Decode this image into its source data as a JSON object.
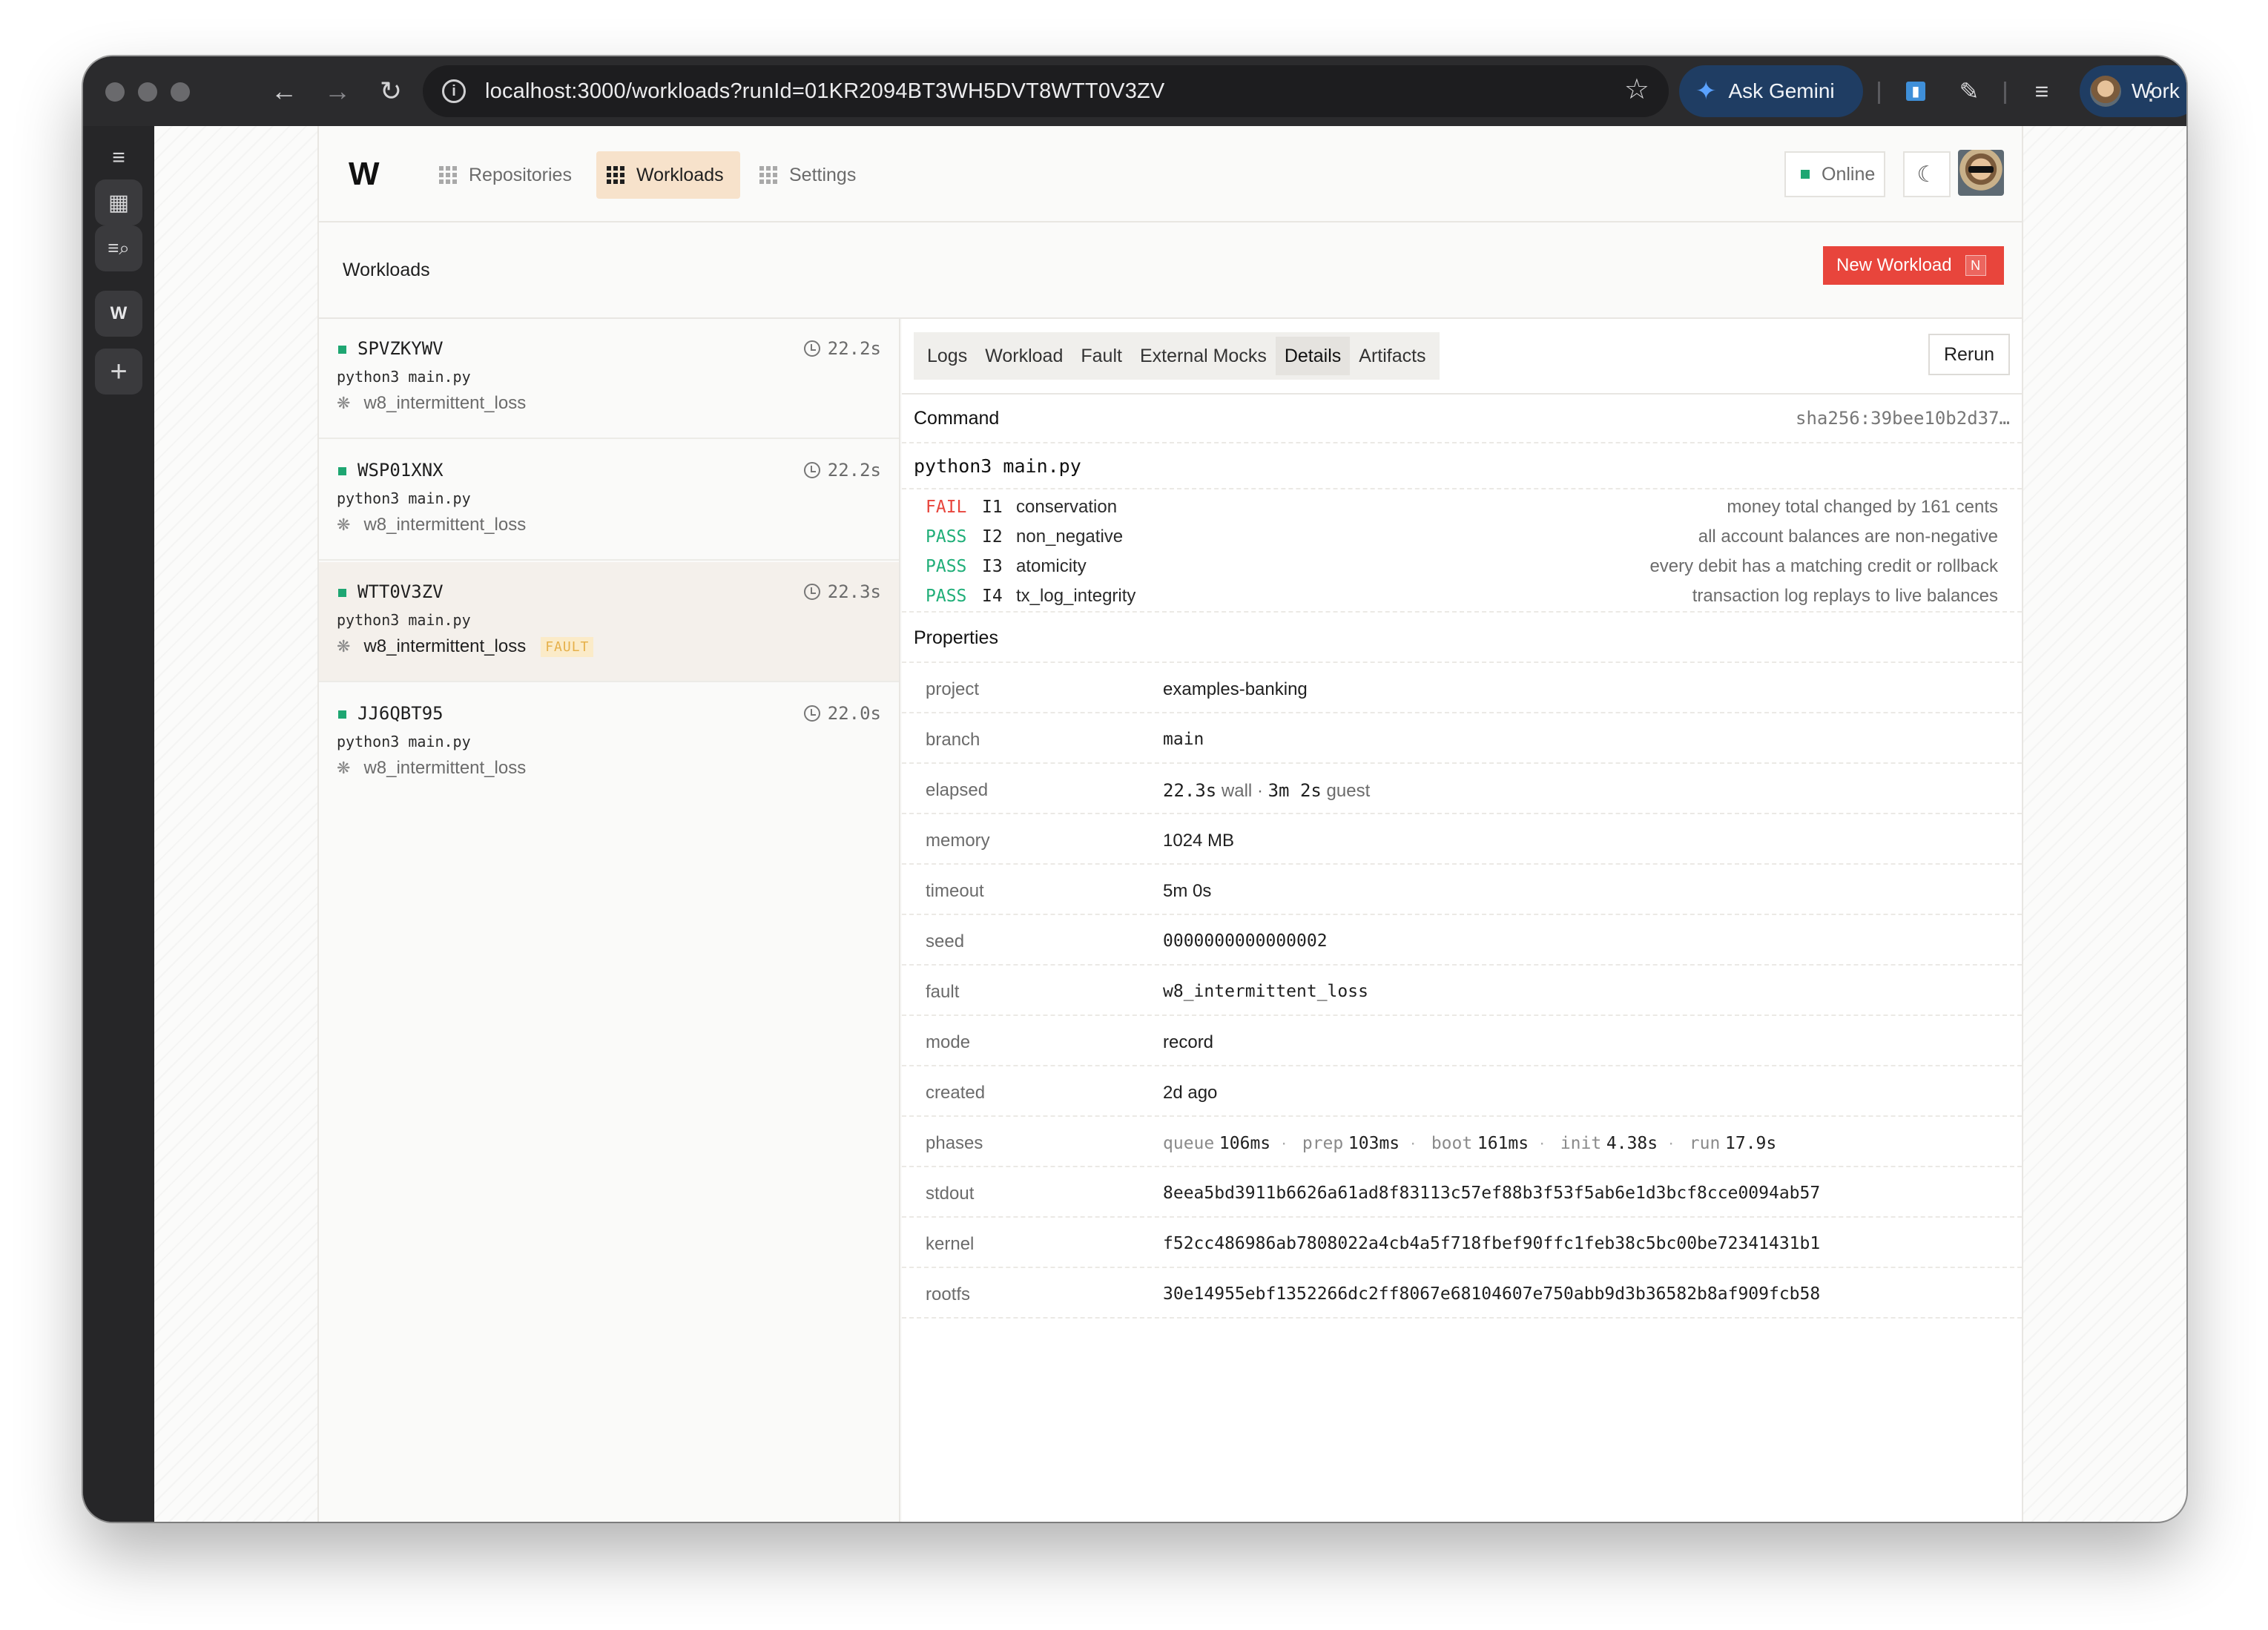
{
  "browser": {
    "url": "localhost:3000/workloads?runId=01KR2094BT3WH5DVT8WTT0V3ZV",
    "ask_gemini": "Ask Gemini",
    "profile": "Work",
    "icons": [
      "back-icon",
      "forward-icon",
      "reload-icon",
      "site-info-icon",
      "bookmark-star-icon",
      "gemini-icon",
      "extension-icon",
      "puzzle-icon",
      "reading-list-icon",
      "menu-icon"
    ]
  },
  "app": {
    "logo": "W",
    "nav": [
      {
        "label": "Repositories",
        "active": false
      },
      {
        "label": "Workloads",
        "active": true
      },
      {
        "label": "Settings",
        "active": false
      }
    ],
    "status": "Online",
    "page_title": "Workloads",
    "new_workload": "New Workload",
    "new_workload_shortcut": "N"
  },
  "workloads": [
    {
      "id": "SPVZKYWV",
      "duration": "22.2s",
      "command": "python3 main.py",
      "fault": "w8_intermittent_loss",
      "selected": false,
      "badge": ""
    },
    {
      "id": "WSP01XNX",
      "duration": "22.2s",
      "command": "python3 main.py",
      "fault": "w8_intermittent_loss",
      "selected": false,
      "badge": ""
    },
    {
      "id": "WTT0V3ZV",
      "duration": "22.3s",
      "command": "python3 main.py",
      "fault": "w8_intermittent_loss",
      "selected": true,
      "badge": "FAULT"
    },
    {
      "id": "JJ6QBT95",
      "duration": "22.0s",
      "command": "python3 main.py",
      "fault": "w8_intermittent_loss",
      "selected": false,
      "badge": ""
    }
  ],
  "detail": {
    "tabs": [
      {
        "label": "Logs",
        "active": false
      },
      {
        "label": "Workload",
        "active": false
      },
      {
        "label": "Fault",
        "active": false
      },
      {
        "label": "External Mocks",
        "active": false
      },
      {
        "label": "Details",
        "active": true
      },
      {
        "label": "Artifacts",
        "active": false
      }
    ],
    "rerun": "Rerun",
    "command_label": "Command",
    "sha": "sha256:39bee10b2d37…",
    "command": "python3 main.py",
    "checks": [
      {
        "status": "FAIL",
        "id": "I1",
        "name": "conservation",
        "desc": "money total changed by 161 cents"
      },
      {
        "status": "PASS",
        "id": "I2",
        "name": "non_negative",
        "desc": "all account balances are non-negative"
      },
      {
        "status": "PASS",
        "id": "I3",
        "name": "atomicity",
        "desc": "every debit has a matching credit or rollback"
      },
      {
        "status": "PASS",
        "id": "I4",
        "name": "tx_log_integrity",
        "desc": "transaction log replays to live balances"
      }
    ],
    "properties_label": "Properties",
    "properties": {
      "project": {
        "key": "project",
        "value": "examples-banking"
      },
      "branch": {
        "key": "branch",
        "value": "main"
      },
      "elapsed": {
        "key": "elapsed",
        "wall_value": "22.3s",
        "wall_unit": "wall",
        "sep": "·",
        "guest_value": "3m 2s",
        "guest_unit": "guest"
      },
      "memory": {
        "key": "memory",
        "value": "1024 MB"
      },
      "timeout": {
        "key": "timeout",
        "value": "5m 0s"
      },
      "seed": {
        "key": "seed",
        "value": "0000000000000002"
      },
      "fault": {
        "key": "fault",
        "value": "w8_intermittent_loss"
      },
      "mode": {
        "key": "mode",
        "value": "record"
      },
      "created": {
        "key": "created",
        "value": "2d ago"
      },
      "phases": {
        "key": "phases",
        "items": [
          {
            "name": "queue",
            "value": "106ms"
          },
          {
            "name": "prep",
            "value": "103ms"
          },
          {
            "name": "boot",
            "value": "161ms"
          },
          {
            "name": "init",
            "value": "4.38s"
          },
          {
            "name": "run",
            "value": "17.9s"
          }
        ]
      },
      "stdout": {
        "key": "stdout",
        "value": "8eea5bd3911b6626a61ad8f83113c57ef88b3f53f5ab6e1d3bcf8cce0094ab57"
      },
      "kernel": {
        "key": "kernel",
        "value": "f52cc486986ab7808022a4cb4a5f718fbef90ffc1feb38c5bc00be72341431b1"
      },
      "rootfs": {
        "key": "rootfs",
        "value": "30e14955ebf1352266dc2ff8067e68104607e750abb9d3b36582b8af909fcb58"
      }
    }
  },
  "colors": {
    "accent": "#e8453c",
    "active_nav": "#f7e2cb",
    "pass": "#1fae78",
    "fail": "#e8453c",
    "online": "#1ea672",
    "fault_badge": "#fbebc8"
  }
}
